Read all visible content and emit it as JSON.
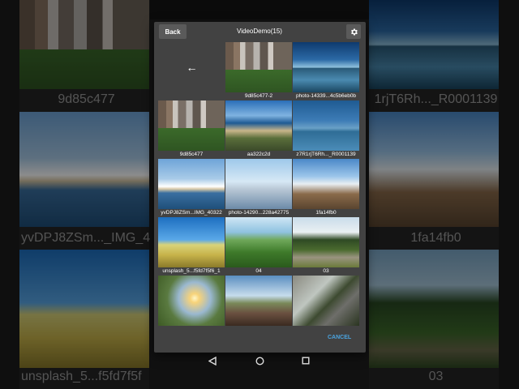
{
  "dialog": {
    "back_label": "Back",
    "title": "VideoDemo(15)",
    "settings_icon": "gear-icon",
    "up_icon": "arrow-left-icon",
    "cancel_label": "CANCEL"
  },
  "grid_items": [
    {
      "caption": "9d85c477-2",
      "scene": "city"
    },
    {
      "caption": "photo-14339...4c5b6eb0b",
      "scene": "lake"
    },
    {
      "caption": "9d85c477",
      "scene": "city"
    },
    {
      "caption": "aa322c2d",
      "scene": "coast"
    },
    {
      "caption": "z7R1rjT6Rh..._R0001139",
      "scene": "tree"
    },
    {
      "caption": "yvDPJ8ZSm...IMG_40322",
      "scene": "beach"
    },
    {
      "caption": "photo-14290...228a42775",
      "scene": "bridge"
    },
    {
      "caption": "1fa14fb0",
      "scene": "pier"
    },
    {
      "caption": "unsplash_5...f5fd7f5f6_1",
      "scene": "field"
    },
    {
      "caption": "04",
      "scene": "grass"
    },
    {
      "caption": "03",
      "scene": "path"
    },
    {
      "caption": "",
      "scene": "sunset"
    },
    {
      "caption": "",
      "scene": "rail"
    },
    {
      "caption": "",
      "scene": "road"
    }
  ],
  "background": {
    "left_captions": [
      "9d85c477",
      "yvDPJ8ZSm..._IMG_40",
      "unsplash_5...f5fd7f5f"
    ],
    "right_captions": [
      "1rjT6Rh..._R0001139",
      "1fa14fb0",
      "03"
    ]
  },
  "navbar": {
    "back_icon": "triangle-back-icon",
    "home_icon": "circle-home-icon",
    "recents_icon": "square-recents-icon"
  },
  "colors": {
    "dialog_bg": "#424242",
    "accent": "#4aa3df"
  }
}
